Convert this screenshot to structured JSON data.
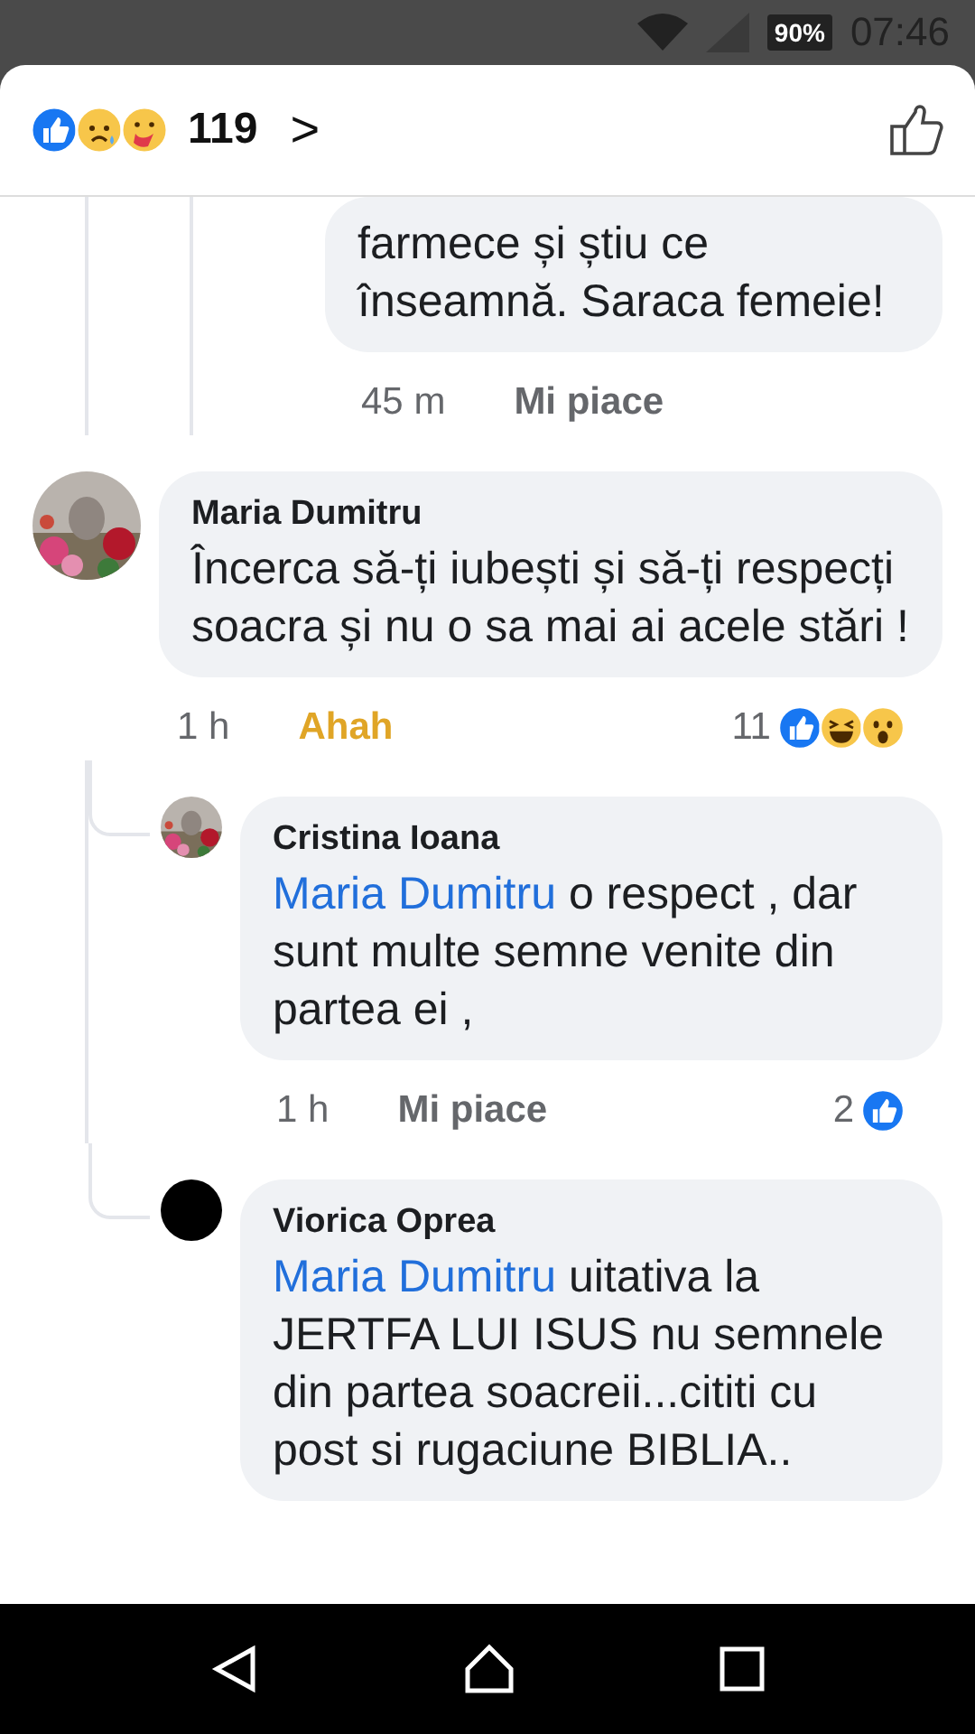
{
  "status_bar": {
    "battery": "90%",
    "time": "07:46"
  },
  "header": {
    "count": "119",
    "chevron": ">"
  },
  "partial_reply": {
    "text": "farmece și știu ce înseamnă. Saraca femeie!",
    "time": "45 m",
    "reaction_label": "Mi piace",
    "reacted": false
  },
  "comment": {
    "author": "Maria Dumitru",
    "text": "Încerca să-ți iubești și să-ți respecți soacra și nu o sa mai ai acele stări !",
    "time": "1 h",
    "reaction_label": "Ahah",
    "reacted": true,
    "reaction_count": "11",
    "replies": [
      {
        "kind": "picture",
        "author": "Cristina Ioana",
        "mention": "Maria Dumitru",
        "text": " o respect , dar sunt multe semne venite din partea ei  ,",
        "time": "1 h",
        "reaction_label": "Mi piace",
        "reacted": false,
        "reaction_count": "2"
      },
      {
        "kind": "plain",
        "author": "Viorica Oprea",
        "mention": "Maria Dumitru",
        "text": "uitativa la JERTFA LUI ISUS nu semnele din partea soacreii...cititi cu post si rugaciune BIBLIA.."
      }
    ]
  }
}
